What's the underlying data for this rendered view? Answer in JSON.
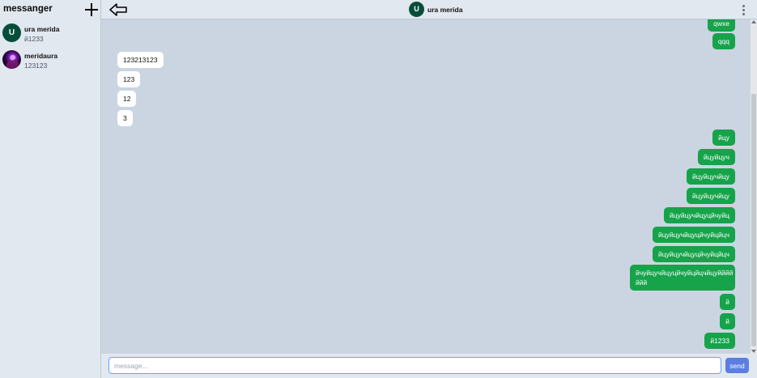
{
  "app": {
    "title": "messanger"
  },
  "sidebar": {
    "chats": [
      {
        "name": "ura merida",
        "last_message": "й1233",
        "avatar_letter": "U"
      },
      {
        "name": "meridaura",
        "last_message": "123123"
      }
    ]
  },
  "header": {
    "peer_name": "ura merida",
    "peer_avatar_letter": "U"
  },
  "messages": [
    {
      "dir": "out",
      "text": "qwxe"
    },
    {
      "dir": "out",
      "text": "qqq"
    },
    {
      "dir": "in",
      "text": "123213123"
    },
    {
      "dir": "in",
      "text": "123"
    },
    {
      "dir": "in",
      "text": "12"
    },
    {
      "dir": "in",
      "text": "3"
    },
    {
      "dir": "out",
      "text": "йцу"
    },
    {
      "dir": "out",
      "text": "йцуйцуч"
    },
    {
      "dir": "out",
      "text": "йцуйцучйцу"
    },
    {
      "dir": "out",
      "text": "йцуйцучйцу"
    },
    {
      "dir": "out",
      "text": "йцуйцучйцуцйчуйц"
    },
    {
      "dir": "out",
      "text": "йцуйцучйцуцйчуйцйцч"
    },
    {
      "dir": "out",
      "text": "йцуйцучйцуцйчуйцйцч"
    },
    {
      "dir": "out",
      "text": "йчуйцучйцуцйчуйцйцчйцуйййй ййй"
    },
    {
      "dir": "out",
      "text": "й"
    },
    {
      "dir": "out",
      "text": "й"
    },
    {
      "dir": "out",
      "text": "й1233"
    }
  ],
  "composer": {
    "placeholder": "message...",
    "value": "",
    "send_label": "send"
  },
  "colors": {
    "outgoing_bubble": "#16a34a",
    "incoming_bubble": "#ffffff",
    "accent": "#5b7fe0",
    "avatar": "#064e3b"
  },
  "icons": {
    "new_chat": "plus-icon",
    "back": "arrow-left-icon",
    "menu": "more-vertical-icon"
  }
}
